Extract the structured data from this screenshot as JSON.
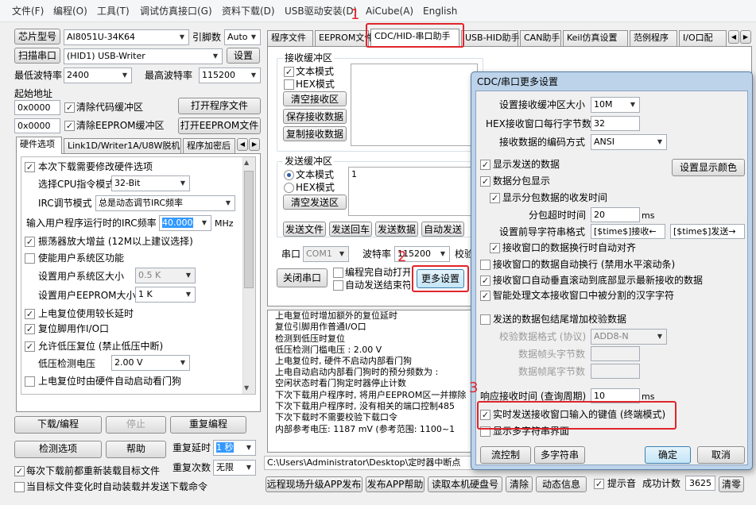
{
  "menu": [
    "文件(F)",
    "编程(O)",
    "工具(T)",
    "调试仿真接口(G)",
    "资料下载(D)",
    "USB驱动安装(D)",
    "AiCube(A)",
    "English"
  ],
  "left": {
    "chip_button": "芯片型号",
    "chip_value": "AI8051U-34K64",
    "pin_label": "引脚数",
    "pin_value": "Auto",
    "scan_button": "扫描串口",
    "port_value": "(HID1) USB-Writer",
    "settings_button": "设置",
    "min_baud_label": "最低波特率",
    "min_baud_value": "2400",
    "max_baud_label": "最高波特率",
    "max_baud_value": "115200",
    "start_addr_label": "起始地址",
    "addr1": "0x0000",
    "clear_code": "清除代码缓冲区",
    "open_prog": "打开程序文件",
    "addr2": "0x0000",
    "clear_eeprom": "清除EEPROM缓冲区",
    "open_eeprom": "打开EEPROM文件",
    "tabs": [
      "硬件选项",
      "Link1D/Writer1A/U8W脱机",
      "程序加密后"
    ],
    "options": {
      "modify_hw": "本次下载需要修改硬件选项",
      "cpu_mode_label": "选择CPU指令模式",
      "cpu_mode_value": "32-Bit",
      "irc_mode_label": "IRC调节模式",
      "irc_mode_value": "总是动态调节IRC频率",
      "irc_freq_label": "输入用户程序运行时的IRC频率",
      "irc_freq_value": "40.000",
      "irc_freq_unit": "MHz",
      "osc_gain": "振荡器放大增益 (12M以上建议选择)",
      "user_sys_area": "使能用户系统区功能",
      "user_sys_size_label": "设置用户系统区大小",
      "user_sys_size_value": "0.5 K",
      "eeprom_size_label": "设置用户EEPROM大小",
      "eeprom_size_value": "1  K",
      "long_reset": "上电复位使用较长延时",
      "reset_io": "复位脚用作I/O口",
      "low_volt_reset": "允许低压复位 (禁止低压中断)",
      "low_volt_label": "低压检测电压",
      "low_volt_value": "2.00 V",
      "watchdog": "上电复位时由硬件自动启动看门狗"
    },
    "download_button": "下载/编程",
    "stop_button": "停止",
    "reprogram_button": "重复编程",
    "check_button": "检测选项",
    "help_button": "帮助",
    "repeat_delay_label": "重复延时",
    "repeat_delay_value": "1 秒",
    "repeat_count_label": "重复次数",
    "repeat_count_value": "无限",
    "reload_each": "每次下载前都重新装载目标文件",
    "auto_reload": "当目标文件变化时自动装载并发送下载命令"
  },
  "tabs_top": [
    "程序文件",
    "EEPROM文件",
    "CDC/HID-串口助手",
    "USB-HID助手",
    "CAN助手",
    "Keil仿真设置",
    "范例程序",
    "I/O口配"
  ],
  "assist": {
    "recv_buffer": "接收缓冲区",
    "text_mode": "文本模式",
    "hex_mode": "HEX模式",
    "clear_recv": "清空接收区",
    "save_recv": "保存接收数据",
    "copy_recv": "复制接收数据",
    "send_buffer": "发送缓冲区",
    "send_text": "文本模式",
    "send_hex": "HEX模式",
    "clear_send": "清空发送区",
    "send_content": "1",
    "send_file": "发送文件",
    "send_return": "发送回车",
    "send_data": "发送数据",
    "auto_send": "自动发送",
    "port_label": "串口",
    "port_value": "COM1",
    "baud_label": "波特率",
    "baud_value": "115200",
    "check_label": "校验",
    "close_port": "关闭串口",
    "auto_open": "编程完自动打开",
    "auto_send_end": "自动发送结束符",
    "more_settings": "更多设置"
  },
  "log_lines": [
    "上电复位时增加额外的复位延时",
    "复位引脚用作普通I/O口",
    "检测到低压时复位",
    "低压检测门槛电压 : 2.00 V",
    "上电复位时, 硬件不启动内部看门狗",
    "上电自动启动内部看门狗时的预分频数为 :",
    "空闲状态时看门狗定时器停止计数",
    "下次下载用户程序时, 将用户EEPROM区一并擦除",
    "下次下载用户程序时, 没有相关的端口控制485",
    "下次下载时不需要校验下载口令",
    "内部参考电压: 1187 mV (参考范围: 1100~1"
  ],
  "path": "C:\\Users\\Administrator\\Desktop\\定时器中断点",
  "bottom": {
    "remote_upgrade": "远程现场升级APP发布",
    "publish_help": "发布APP帮助",
    "read_disk": "读取本机硬盘号",
    "clear": "清除",
    "anim": "动态信息",
    "beep": "提示音",
    "success_label": "成功计数",
    "success_value": "3625",
    "clear_count": "清零"
  },
  "dialog": {
    "title": "CDC/串口更多设置",
    "recv_buf_size_label": "设置接收缓冲区大小",
    "recv_buf_size_value": "10M",
    "hex_bytes_label": "HEX接收窗口每行字节数",
    "hex_bytes_value": "32",
    "encoding_label": "接收数据的编码方式",
    "encoding_value": "ANSI",
    "show_sent": "显示发送的数据",
    "set_color": "设置显示颜色",
    "packet_display": "数据分包显示",
    "show_packet_time": "显示分包数据的收发时间",
    "packet_timeout_label": "分包超时时间",
    "packet_timeout_value": "20",
    "packet_timeout_unit": "ms",
    "prefix_label": "设置前导字符串格式",
    "prefix_recv": "[$time$]接收←",
    "prefix_send": "[$time$]发送→",
    "recv_line_align": "接收窗口的数据换行时自动对齐",
    "auto_wrap": "接收窗口的数据自动换行 (禁用水平滚动条)",
    "auto_scroll": "接收窗口自动垂直滚动到底部显示最新接收的数据",
    "smart_cn": "智能处理文本接收窗口中被分割的汉字字符",
    "add_checksum": "发送的数据包结尾增加校验数据",
    "checksum_format_label": "校验数据格式 (协议)",
    "checksum_format_value": "ADD8-N",
    "frame_head_label": "数据帧头字节数",
    "frame_tail_label": "数据帧尾字节数",
    "resp_interval_label": "响应接收时间 (查询周期)",
    "resp_interval_value": "10",
    "resp_interval_unit": "ms",
    "realtime_send": "实时发送接收窗口输入的键值 (终端模式)",
    "multi_string": "显示多字符串界面",
    "flow_control": "流控制",
    "multi_string_btn": "多字符串",
    "ok": "确定",
    "cancel": "取消"
  },
  "annotations": [
    "1",
    "2",
    "3"
  ]
}
